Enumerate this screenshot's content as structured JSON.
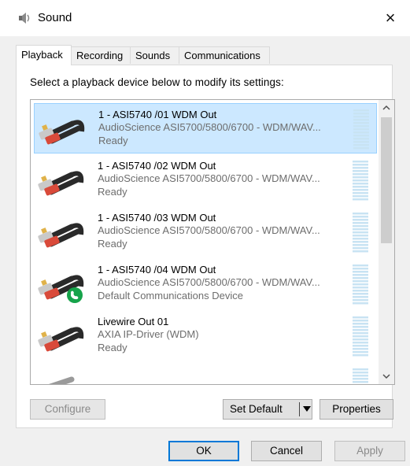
{
  "window": {
    "title": "Sound",
    "close_glyph": "×",
    "icon": "speaker-icon"
  },
  "tabs": [
    {
      "label": "Playback",
      "active": true
    },
    {
      "label": "Recording",
      "active": false
    },
    {
      "label": "Sounds",
      "active": false
    },
    {
      "label": "Communications",
      "active": false
    }
  ],
  "instruction": "Select a playback device below to modify its settings:",
  "devices": [
    {
      "name": "1 - ASI5740 /01 WDM Out",
      "description": "AudioScience ASI5700/5800/6700 - WDM/WAV...",
      "status": "Ready",
      "selected": true,
      "badge": null
    },
    {
      "name": "1 - ASI5740 /02 WDM Out",
      "description": "AudioScience ASI5700/5800/6700 - WDM/WAV...",
      "status": "Ready",
      "selected": false,
      "badge": null
    },
    {
      "name": "1 - ASI5740 /03 WDM Out",
      "description": "AudioScience ASI5700/5800/6700 - WDM/WAV...",
      "status": "Ready",
      "selected": false,
      "badge": null
    },
    {
      "name": "1 - ASI5740 /04 WDM Out",
      "description": "AudioScience ASI5700/5800/6700 - WDM/WAV...",
      "status": "Default Communications Device",
      "selected": false,
      "badge": "phone-icon"
    },
    {
      "name": "Livewire Out 01",
      "description": "AXIA IP-Driver (WDM)",
      "status": "Ready",
      "selected": false,
      "badge": null
    }
  ],
  "buttons": {
    "configure": "Configure",
    "set_default": "Set Default",
    "properties": "Properties",
    "ok": "OK",
    "cancel": "Cancel",
    "apply": "Apply"
  },
  "colors": {
    "selection": "#cce8ff",
    "selection_border": "#99d1ff",
    "badge_green": "#16a34a",
    "accent": "#0078d7"
  }
}
